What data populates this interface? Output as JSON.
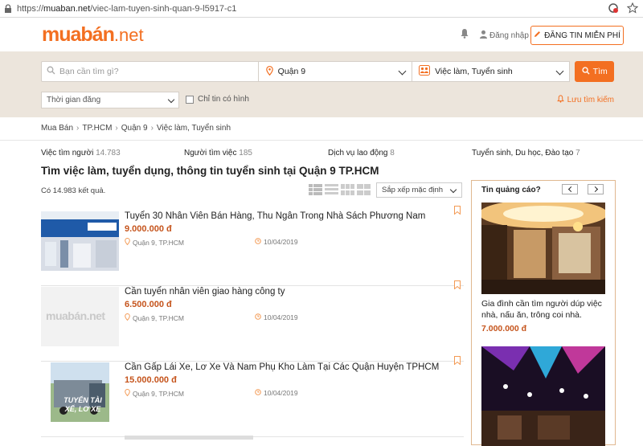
{
  "browser": {
    "url_prefix": "https://",
    "url_host": "muaban.net",
    "url_path": "/viec-lam-tuyen-sinh-quan-9-l5917-c1"
  },
  "header": {
    "logo_main": "muabán",
    "logo_suffix": ".net",
    "login_label": "Đăng nhập",
    "post_button": "ĐĂNG TIN MIỄN PHÍ"
  },
  "search": {
    "placeholder": "Bạn cần tìm gì?",
    "district": "Quận 9",
    "category": "Việc làm, Tuyển sinh",
    "button": "Tìm",
    "time_filter": "Thời gian đăng",
    "image_only_label": "Chỉ tin có hình",
    "save_search": "Lưu tìm kiếm"
  },
  "breadcrumb": [
    "Mua Bán",
    "TP.HCM",
    "Quận 9",
    "Việc làm, Tuyển sinh"
  ],
  "category_counts": [
    {
      "label": "Việc tìm người",
      "count": "14.783"
    },
    {
      "label": "Người tìm việc",
      "count": "185"
    },
    {
      "label": "Dịch vụ lao động",
      "count": "8"
    },
    {
      "label": "Tuyển sinh, Du học, Đào tạo",
      "count": "7"
    }
  ],
  "page_title": "Tìm việc làm, tuyển dụng, thông tin tuyển sinh tại Quận 9 TP.HCM",
  "results_text": "Có 14.983 kết quả.",
  "sort_label": "Sắp xếp mặc định",
  "listings": [
    {
      "title": "Tuyển 30 Nhân Viên Bán Hàng, Thu Ngân Trong Nhà Sách Phương Nam",
      "price": "9.000.000 đ",
      "location": "Quận 9, TP.HCM",
      "date": "10/04/2019",
      "thumb_text": "Phương Nam"
    },
    {
      "title": "Cần tuyển nhân viên giao hàng công ty",
      "price": "6.500.000 đ",
      "location": "Quận 9, TP.HCM",
      "date": "10/04/2019",
      "thumb_text": "muabán.net"
    },
    {
      "title": "Cần Gấp Lái Xe, Lơ Xe Và Nam Phụ Kho Làm Tại Các Quận Huyện TPHCM",
      "price": "15.000.000 đ",
      "location": "Quận 9, TP.HCM",
      "date": "10/04/2019",
      "thumb_text": "TUYỂN TÀI XẾ, LƠ XE"
    }
  ],
  "ads": {
    "heading": "Tin quảng cáo?",
    "ad1_text": "Gia đình cần tìm người dúp việc nhà, nấu ăn, trông coi nhà.",
    "ad1_price": "7.000.000 đ"
  },
  "colors": {
    "brand": "#f36f21",
    "price": "#c5541c",
    "search_bg": "#ece5dc"
  }
}
